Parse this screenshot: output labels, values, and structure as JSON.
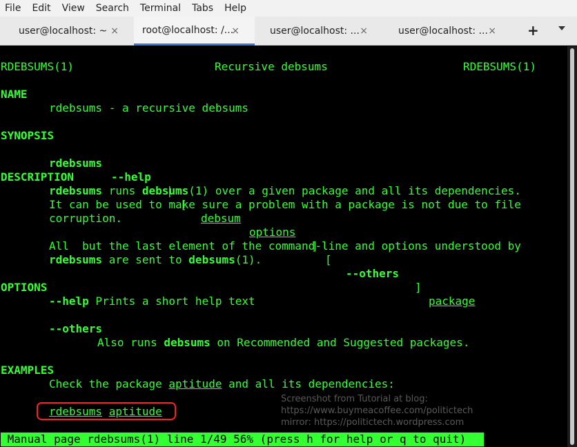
{
  "menu": [
    "File",
    "Edit",
    "View",
    "Search",
    "Terminal",
    "Tabs",
    "Help"
  ],
  "tabs": [
    {
      "label": "user@localhost: ~",
      "active": false
    },
    {
      "label": "root@localhost: /...",
      "active": true
    },
    {
      "label": "user@localhost: ...",
      "active": false
    },
    {
      "label": "user@localhost: ...",
      "active": false
    }
  ],
  "tab_close": "×",
  "new_tab": "+",
  "man": {
    "header_left": "RDEBSUMS(1)",
    "header_center": "Recursive debsums",
    "header_right": "RDEBSUMS(1)",
    "name_heading": "NAME",
    "name_text": "rdebsums - a recursive debsums",
    "synopsis_heading": "SYNOPSIS",
    "syn_cmd": "rdebsums",
    "syn_help": "--help",
    "syn_bar": "|",
    "syn_lb1": "[",
    "syn_debsum": "debsum",
    "syn_options": "options",
    "syn_rb1": "]",
    "syn_lb2": "[",
    "syn_others": "--others",
    "syn_rb2": "]",
    "syn_package": "package",
    "description_heading": "DESCRIPTION",
    "d1_cmd": "rdebsums",
    "d1_mid": " runs ",
    "d1_debsums": "debsums",
    "d1_rest": "(1) over a given package and all its dependencies.",
    "d2": "It can be used to make sure a problem with a package is not due to file",
    "d3": "corruption.",
    "d4": "All  but the last element of the command-line and options understood by",
    "d5_cmd": "rdebsums",
    "d5_mid": " are sent to ",
    "d5_debsums": "debsums",
    "d5_rest": "(1).",
    "options_heading": "OPTIONS",
    "opt_help": "--help",
    "opt_help_desc": " Prints a short help text",
    "opt_others": "--others",
    "opt_others_pre": "Also runs ",
    "opt_others_cmd": "debsums",
    "opt_others_rest": " on Recommended and Suggested packages.",
    "examples_heading": "EXAMPLES",
    "ex_pre": "Check the package ",
    "ex_pkg": "aptitude",
    "ex_rest": " and all its dependencies:",
    "ex_cmd": "rdebsums",
    "ex_arg": "aptitude"
  },
  "status": " Manual page rdebsums(1) line 1/49 56% (press h for help or q to quit)",
  "watermark": [
    "Screenshot from Tutorial at blog:",
    "https://www.buymeacoffee.com/politictech",
    "mirror: https://politictech.wordpress.com"
  ],
  "colors": {
    "terminal_fg": "#33ff33",
    "terminal_bg": "#000000",
    "highlight": "#ff2020",
    "active_tab": "#3a7bd5"
  }
}
